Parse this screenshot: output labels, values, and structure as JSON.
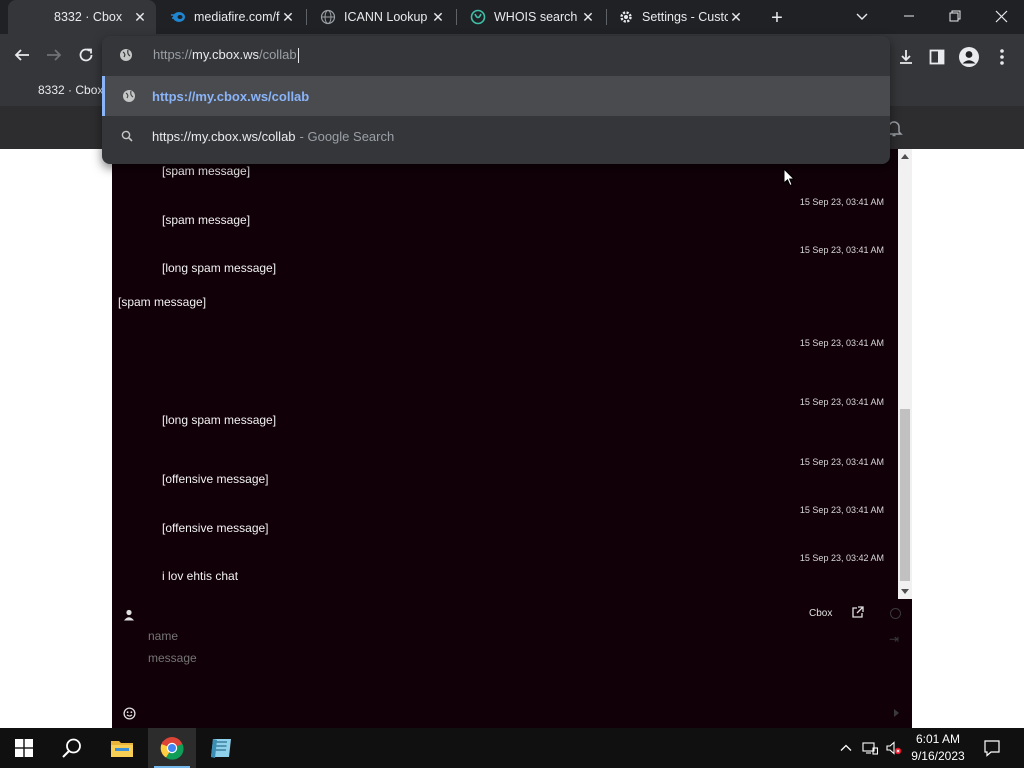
{
  "browser": {
    "tabs": [
      {
        "title": "8332 · Cbox",
        "icon": "cbox-favicon",
        "active": true
      },
      {
        "title": "mediafire.com/f",
        "icon": "mediafire-favicon",
        "active": false
      },
      {
        "title": "ICANN Lookup",
        "icon": "icann-favicon",
        "active": false
      },
      {
        "title": "WHOIS search r",
        "icon": "whois-favicon",
        "active": false
      },
      {
        "title": "Settings - Custo",
        "icon": "gear-icon",
        "active": false
      }
    ],
    "omnibox": {
      "prefix": "https://",
      "host": "my.cbox.ws",
      "path": "/collab"
    },
    "suggestions": [
      {
        "text": "https://my.cbox.ws/collab",
        "sub": "",
        "icon": "globe-icon",
        "selected": true
      },
      {
        "text": "https://my.cbox.ws/collab",
        "sub": "- Google Search",
        "icon": "search-icon",
        "selected": false
      }
    ],
    "bookmark": "8332 · Cbox"
  },
  "chat": {
    "messages": [
      {
        "text": "[spam message]",
        "stamp": ""
      },
      {
        "text": "[spam message]",
        "stamp": "15 Sep 23, 03:41 AM"
      },
      {
        "text": "[long spam message]",
        "stamp": "15 Sep 23, 03:41 AM"
      },
      {
        "text": "[spam message]",
        "stamp": ""
      },
      {
        "text": "",
        "stamp": "15 Sep 23, 03:41 AM"
      },
      {
        "text": "",
        "stamp": "15 Sep 23, 03:41 AM"
      },
      {
        "text": "[long spam message]",
        "stamp": ""
      },
      {
        "text": "[offensive message]",
        "stamp": "15 Sep 23, 03:41 AM"
      },
      {
        "text": "[offensive message]",
        "stamp": "15 Sep 23, 03:41 AM"
      },
      {
        "text": "i lov ehtis chat",
        "stamp": "15 Sep 23, 03:42 AM"
      }
    ]
  },
  "composer": {
    "cbox_label": "Cbox",
    "name_placeholder": "name",
    "message_placeholder": "message"
  },
  "taskbar": {
    "time": "6:01 AM",
    "date": "9/16/2023"
  },
  "colors": {
    "accent": "#8ab4f8",
    "cbox_bg": "#110008",
    "chrome_dark": "#202124",
    "chrome_toolbar": "#35363a"
  }
}
